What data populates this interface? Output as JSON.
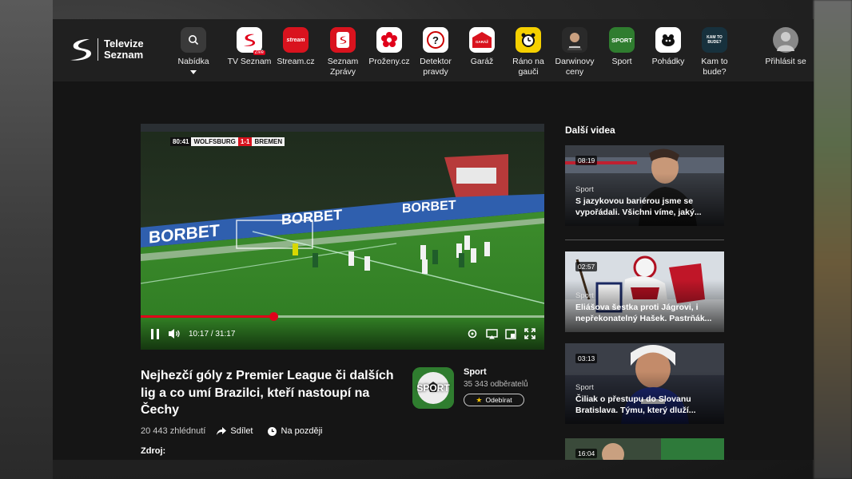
{
  "header": {
    "logo_line1": "Televize",
    "logo_line2": "Seznam",
    "nav": [
      {
        "label": "Nabídka",
        "icon": "search-icon"
      },
      {
        "label": "TV Seznam",
        "icon": "tv-seznam-icon",
        "badge": "Živě"
      },
      {
        "label": "Stream.cz",
        "icon": "stream-icon",
        "icon_text": "stream"
      },
      {
        "label": "Seznam Zprávy",
        "icon": "seznam-zpravy-icon"
      },
      {
        "label": "Proženy.cz",
        "icon": "flower-icon"
      },
      {
        "label": "Detektor pravdy",
        "icon": "question-icon"
      },
      {
        "label": "Garáž",
        "icon": "garage-icon",
        "icon_text": "GARÁŽ"
      },
      {
        "label": "Ráno na gauči",
        "icon": "alarm-clock-icon"
      },
      {
        "label": "Darwinovy ceny",
        "icon": "darwin-icon"
      },
      {
        "label": "Sport",
        "icon": "sport-icon",
        "icon_text": "SPORT"
      },
      {
        "label": "Pohádky",
        "icon": "fairytale-icon"
      },
      {
        "label": "Kam to bude?",
        "icon": "kam-to-bude-icon",
        "icon_text": "KAM TO BUDE?"
      }
    ],
    "login_label": "Přihlásit se"
  },
  "player": {
    "scoreboard": {
      "clock": "80:41",
      "home": "WOLFSBURG",
      "score": "1-1",
      "away": "BREMEN"
    },
    "ad_text": "BORBET",
    "current_time": "10:17",
    "separator": "/",
    "duration": "31:17",
    "progress": 0.329
  },
  "video": {
    "title": "Nejhezčí góly z Premier League či dalších lig a co umí Brazilci, kteří nastoupí na Čechy",
    "views": "20 443 zhlédnutí",
    "share_label": "Sdílet",
    "later_label": "Na později",
    "source_label": "Zdroj:"
  },
  "channel": {
    "name": "Sport",
    "subscribers": "35 343 odběratelů",
    "subscribe_label": "Odebírat",
    "logo_text": "SPORT"
  },
  "sidebar": {
    "heading": "Další videa",
    "videos": [
      {
        "duration": "08:19",
        "category": "Sport",
        "title": "S jazykovou bariérou jsme se vypořádali. Všichni víme, jaký..."
      },
      {
        "duration": "02:57",
        "category": "Sport",
        "title": "Eliášova šestka proti Jágrovi, i nepřekonatelný Hašek. Pastrňák..."
      },
      {
        "duration": "03:13",
        "category": "Sport",
        "title": "Čiliak o přestupu do Slovanu Bratislava. Týmu, který dluží..."
      },
      {
        "duration": "16:04"
      }
    ]
  },
  "colors": {
    "accent": "#e0001a",
    "background": "#151515",
    "topbar": "#202020"
  }
}
